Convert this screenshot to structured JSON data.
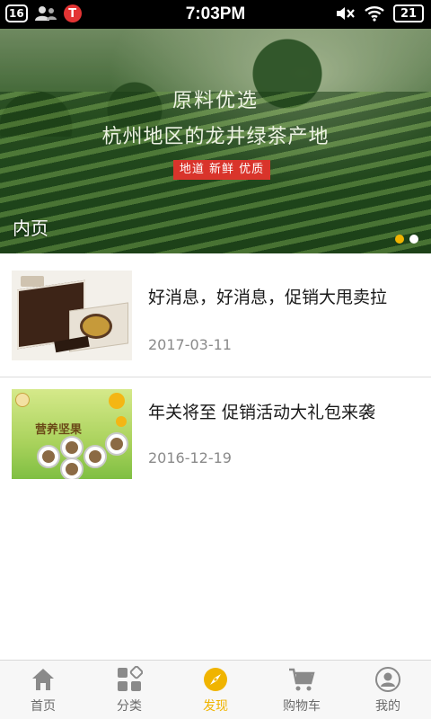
{
  "status_bar": {
    "notification_count": "16",
    "app_badge": "T",
    "time": "7:03PM",
    "battery": "21"
  },
  "banner": {
    "headline": "原料优选",
    "subheadline": "杭州地区的龙井绿茶产地",
    "tag": "地道 新鲜 优质",
    "caption": "内页",
    "slides": 2,
    "active_slide": 1
  },
  "news": [
    {
      "title": "好消息，好消息，促销大甩卖拉",
      "date": "2017-03-11",
      "image": "chocolate-gift-box"
    },
    {
      "title": "年关将至 促销活动大礼包来袭",
      "date": "2016-12-19",
      "image": "nuts-gift-set",
      "image_text": "营养坚果"
    }
  ],
  "tabs": [
    {
      "label": "首页",
      "icon": "home-icon",
      "active": false
    },
    {
      "label": "分类",
      "icon": "category-icon",
      "active": false
    },
    {
      "label": "发现",
      "icon": "compass-icon",
      "active": true
    },
    {
      "label": "购物车",
      "icon": "cart-icon",
      "active": false
    },
    {
      "label": "我的",
      "icon": "user-icon",
      "active": false
    }
  ],
  "colors": {
    "accent": "#f0b400",
    "tag_red": "#d9342b",
    "text": "#1a1a1a",
    "muted": "#8a8a8a"
  }
}
